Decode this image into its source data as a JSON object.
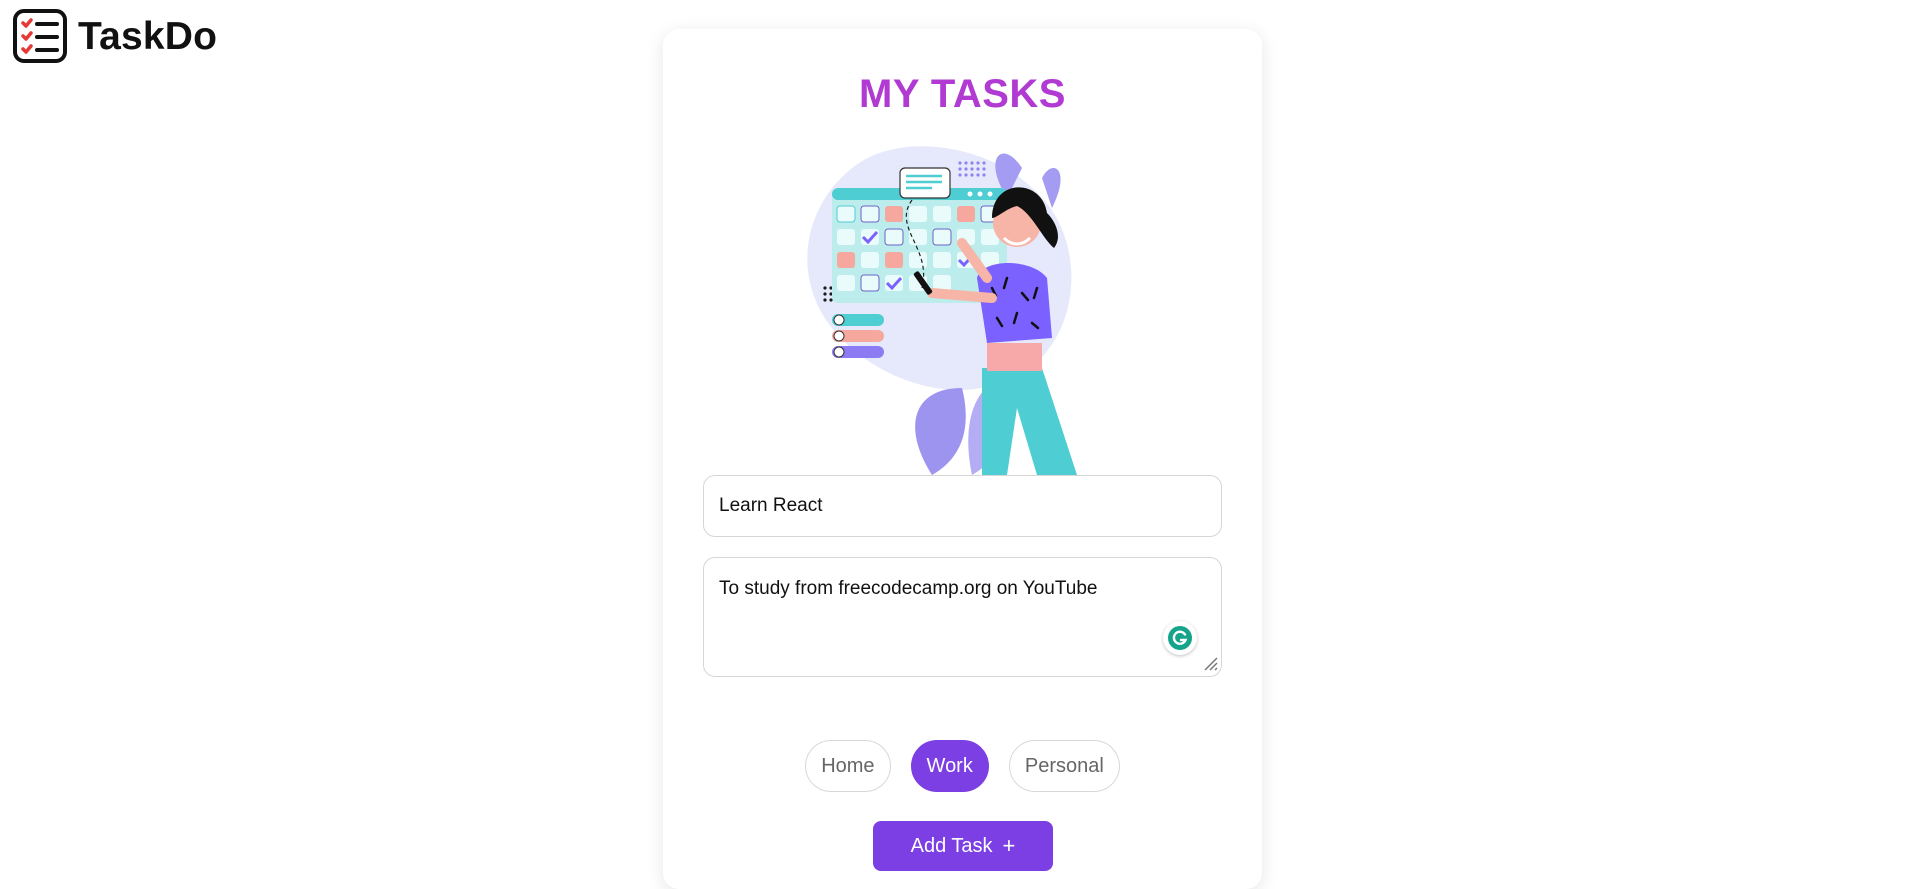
{
  "app": {
    "name": "TaskDo",
    "icon": "checklist-icon"
  },
  "card": {
    "title": "MY TASKS"
  },
  "form": {
    "task_title_value": "Learn React",
    "task_description_value": "To study from freecodecamp.org on YouTube",
    "categories": [
      "Home",
      "Work",
      "Personal"
    ],
    "selected_category": "Work",
    "add_button_label": "Add Task",
    "add_button_icon": "plus-icon"
  },
  "colors": {
    "accent": "#7b3fe4",
    "title": "#b13ad3"
  },
  "extension": {
    "icon": "grammarly-icon"
  }
}
